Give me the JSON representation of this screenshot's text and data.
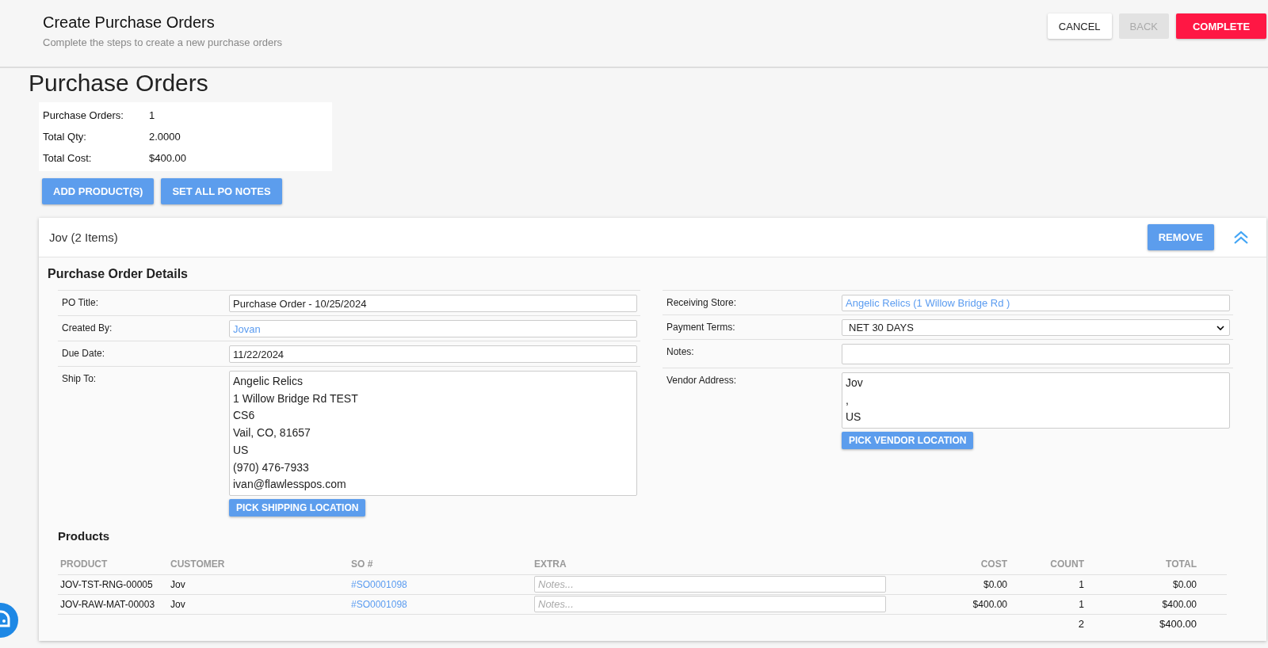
{
  "header": {
    "title": "Create Purchase Orders",
    "subtitle": "Complete the steps to create a new purchase orders",
    "buttons": [
      {
        "label": "CANCEL",
        "kind": "secondary",
        "disabled": false
      },
      {
        "label": "BACK",
        "kind": "secondary",
        "disabled": true
      },
      {
        "label": "COMPLETE",
        "kind": "primary",
        "disabled": false
      }
    ]
  },
  "page_heading": "Purchase Orders",
  "summary": [
    {
      "label": "Purchase Orders:",
      "value": "1"
    },
    {
      "label": "Total Qty:",
      "value": "2.0000"
    },
    {
      "label": "Total Cost:",
      "value": "$400.00"
    }
  ],
  "actions": [
    "ADD PRODUCT(S)",
    "SET ALL PO NOTES"
  ],
  "po_card": {
    "title": "Jov (2 Items)",
    "remove_label": "REMOVE",
    "expanded": true,
    "details_title": "Purchase Order Details",
    "left_fields": [
      {
        "label": "PO Title:",
        "kind": "text",
        "value": "Purchase Order - 10/25/2024"
      },
      {
        "label": "Created By:",
        "kind": "link",
        "value": "Jovan"
      },
      {
        "label": "Due Date:",
        "kind": "text",
        "value": "11/22/2024"
      },
      {
        "label": "Ship To:",
        "kind": "address",
        "lines": [
          "Angelic Relics",
          "1 Willow Bridge Rd TEST",
          "CS6",
          "Vail, CO, 81657",
          "US",
          "(970) 476-7933",
          "ivan@flawlesspos.com"
        ],
        "button": "PICK SHIPPING LOCATION"
      }
    ],
    "right_fields": [
      {
        "label": "Receiving Store:",
        "kind": "link",
        "value": "Angelic Relics (1 Willow Bridge Rd )"
      },
      {
        "label": "Payment Terms:",
        "kind": "select",
        "value": "NET 30 DAYS"
      },
      {
        "label": "Notes:",
        "kind": "text"
      },
      {
        "label": "Vendor Address:",
        "kind": "address",
        "lines": [
          "Jov",
          ",",
          "US"
        ],
        "button": "PICK VENDOR LOCATION"
      }
    ],
    "products_title": "Products",
    "columns": [
      "PRODUCT",
      "CUSTOMER",
      "SO #",
      "EXTRA",
      "COST",
      "COUNT",
      "TOTAL"
    ],
    "rows": [
      {
        "product": "JOV-TST-RNG-00005",
        "customer": "Jov",
        "so": "#SO0001098",
        "extra_placeholder": "Notes...",
        "cost": "$0.00",
        "count": "1",
        "total": "$0.00"
      },
      {
        "product": "JOV-RAW-MAT-00003",
        "customer": "Jov",
        "so": "#SO0001098",
        "extra_placeholder": "Notes...",
        "cost": "$400.00",
        "count": "1",
        "total": "$400.00"
      }
    ],
    "totals": {
      "count": "2",
      "total": "$400.00"
    }
  }
}
